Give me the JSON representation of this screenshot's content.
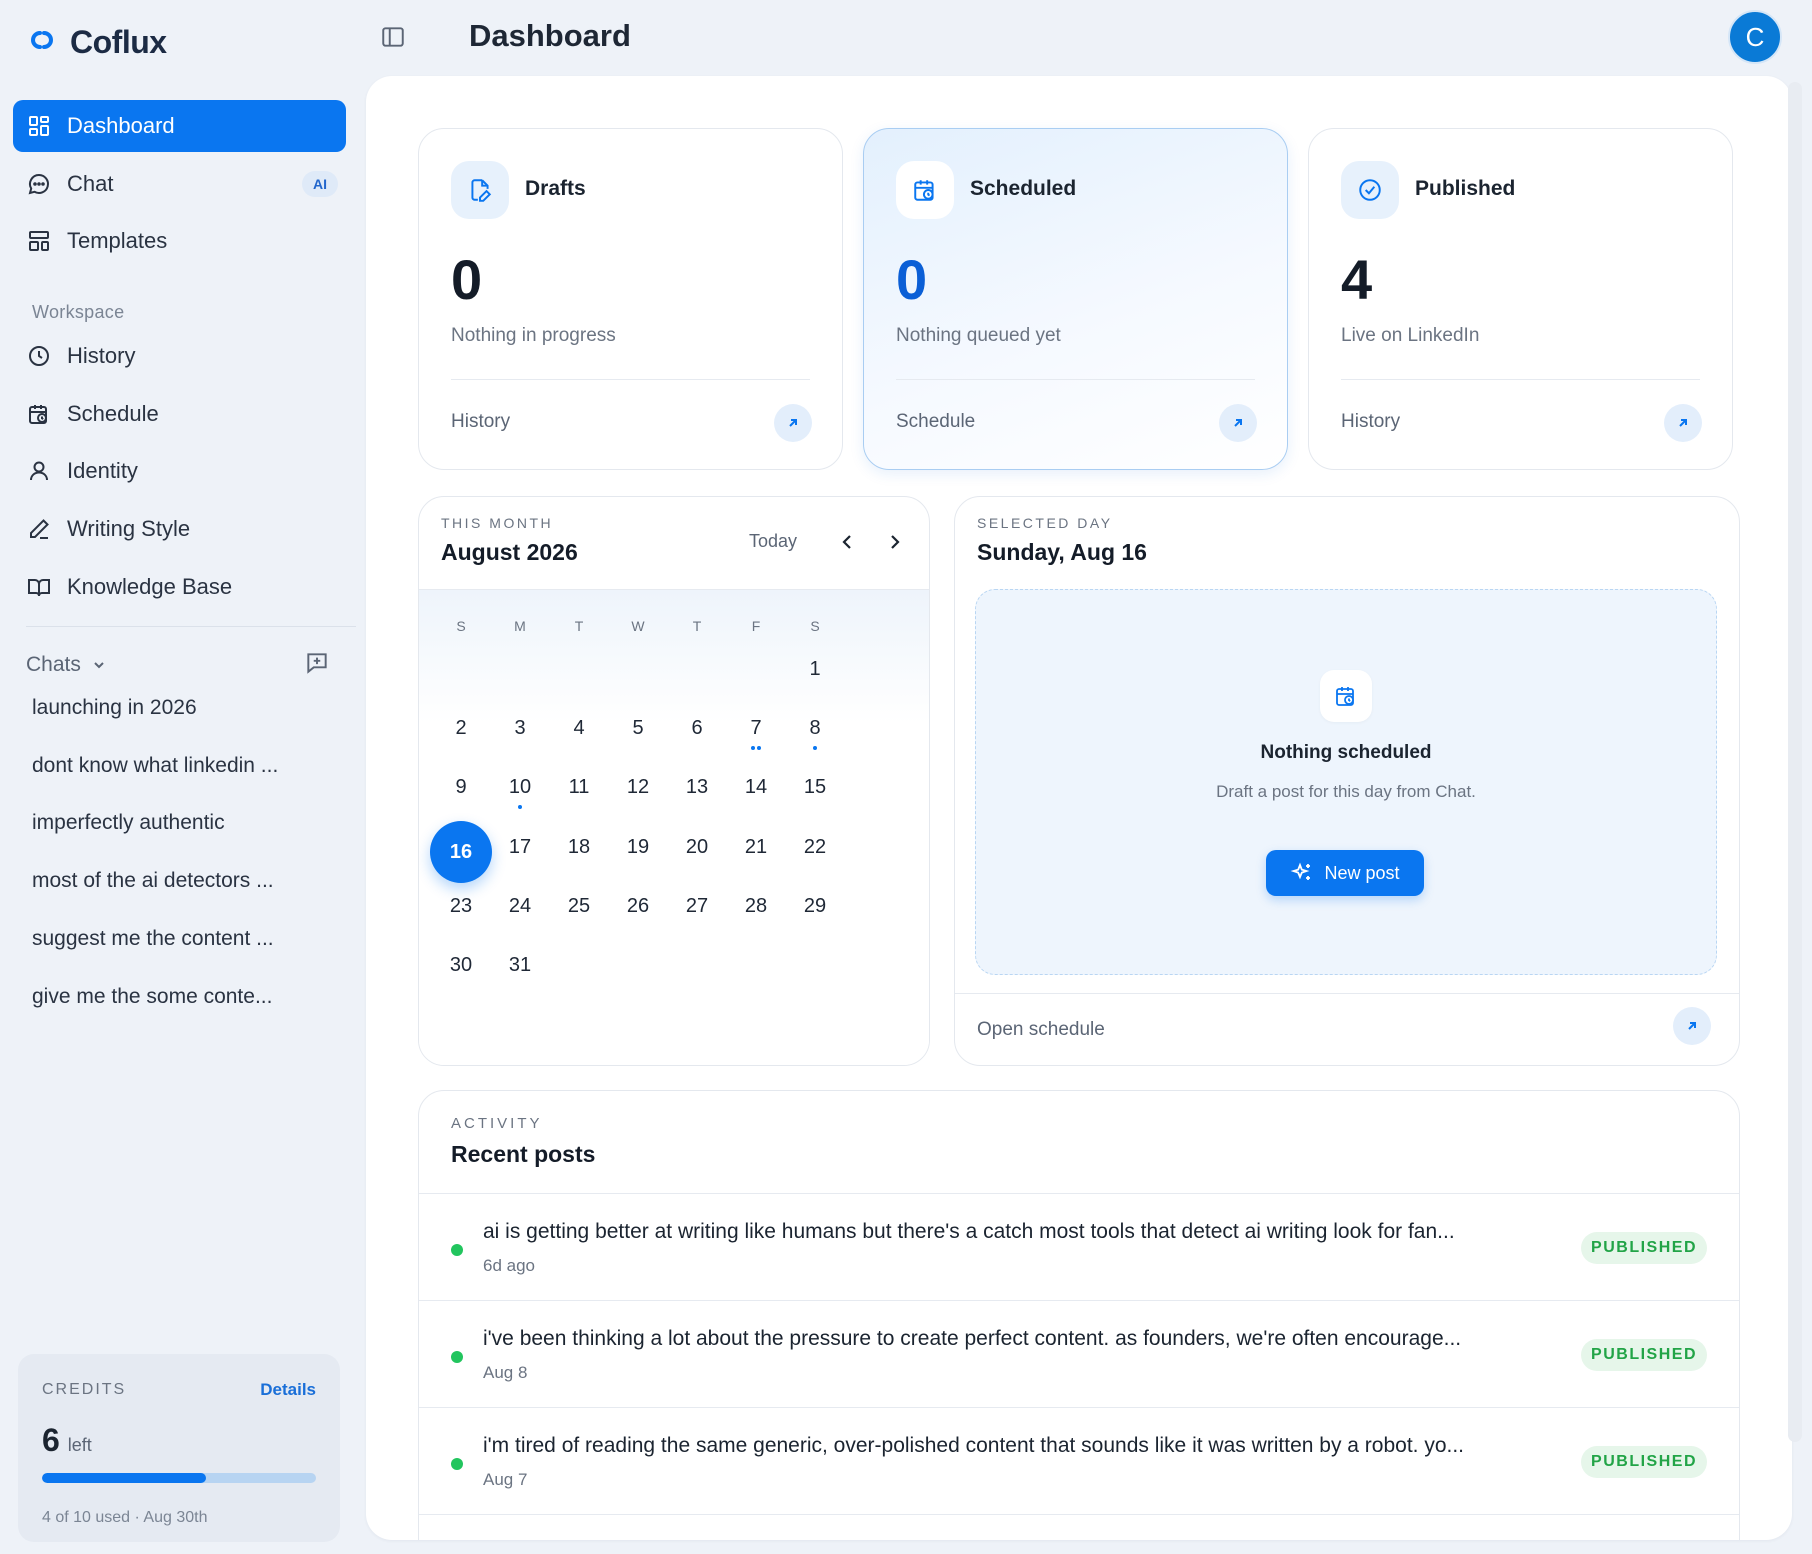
{
  "brand": {
    "name": "Coflux"
  },
  "header": {
    "title": "Dashboard",
    "avatar_initial": "C"
  },
  "sidebar": {
    "nav": [
      {
        "label": "Dashboard",
        "icon": "dashboard-grid-icon",
        "active": true
      },
      {
        "label": "Chat",
        "icon": "chat-bubble-icon",
        "badge": "AI"
      },
      {
        "label": "Templates",
        "icon": "templates-layout-icon"
      }
    ],
    "workspace_label": "Workspace",
    "workspace": [
      {
        "label": "History",
        "icon": "clock-icon"
      },
      {
        "label": "Schedule",
        "icon": "calendar-clock-icon"
      },
      {
        "label": "Identity",
        "icon": "user-icon"
      },
      {
        "label": "Writing Style",
        "icon": "pen-icon"
      },
      {
        "label": "Knowledge Base",
        "icon": "book-icon"
      }
    ],
    "chats_label": "Chats",
    "chats": [
      "launching in 2026",
      "dont know what linkedin ...",
      "imperfectly authentic",
      "most of the ai detectors ...",
      "suggest me the content ...",
      "give me the some conte..."
    ],
    "credits": {
      "label": "CREDITS",
      "details_label": "Details",
      "count": "6",
      "unit": "left",
      "used_fraction": 0.6,
      "footer": "4 of 10 used · Aug 30th"
    }
  },
  "stats": [
    {
      "title": "Drafts",
      "value": "0",
      "subtitle": "Nothing in progress",
      "link": "History",
      "icon": "draft-document-icon",
      "highlight": false
    },
    {
      "title": "Scheduled",
      "value": "0",
      "subtitle": "Nothing queued yet",
      "link": "Schedule",
      "icon": "calendar-clock-icon",
      "highlight": true
    },
    {
      "title": "Published",
      "value": "4",
      "subtitle": "Live on LinkedIn",
      "link": "History",
      "icon": "check-circle-icon",
      "highlight": false
    }
  ],
  "calendar": {
    "eyebrow": "THIS MONTH",
    "title": "August 2026",
    "today_label": "Today",
    "weekdays": [
      "S",
      "M",
      "T",
      "W",
      "T",
      "F",
      "S"
    ],
    "first_weekday": 6,
    "days_in_month": 31,
    "selected_day": 16,
    "dots": {
      "7": 2,
      "8": 1,
      "10": 1
    }
  },
  "selected_day": {
    "eyebrow": "SELECTED DAY",
    "title": "Sunday, Aug 16",
    "empty_title": "Nothing scheduled",
    "empty_text": "Draft a post for this day from Chat.",
    "new_post_label": "New post",
    "open_schedule_label": "Open schedule"
  },
  "activity": {
    "eyebrow": "ACTIVITY",
    "title": "Recent posts",
    "posts": [
      {
        "text": "ai is getting better at writing like humans but there's a catch most tools that detect ai writing look for fan...",
        "date": "6d ago",
        "status": "PUBLISHED"
      },
      {
        "text": "i've been thinking a lot about the pressure to create perfect content. as founders, we're often encourage...",
        "date": "Aug 8",
        "status": "PUBLISHED"
      },
      {
        "text": "i'm tired of reading the same generic, over-polished content that sounds like it was written by a robot. yo...",
        "date": "Aug 7",
        "status": "PUBLISHED"
      }
    ]
  },
  "colors": {
    "accent": "#0a76f0",
    "published": "#22c55e",
    "background": "#eef2f8"
  }
}
